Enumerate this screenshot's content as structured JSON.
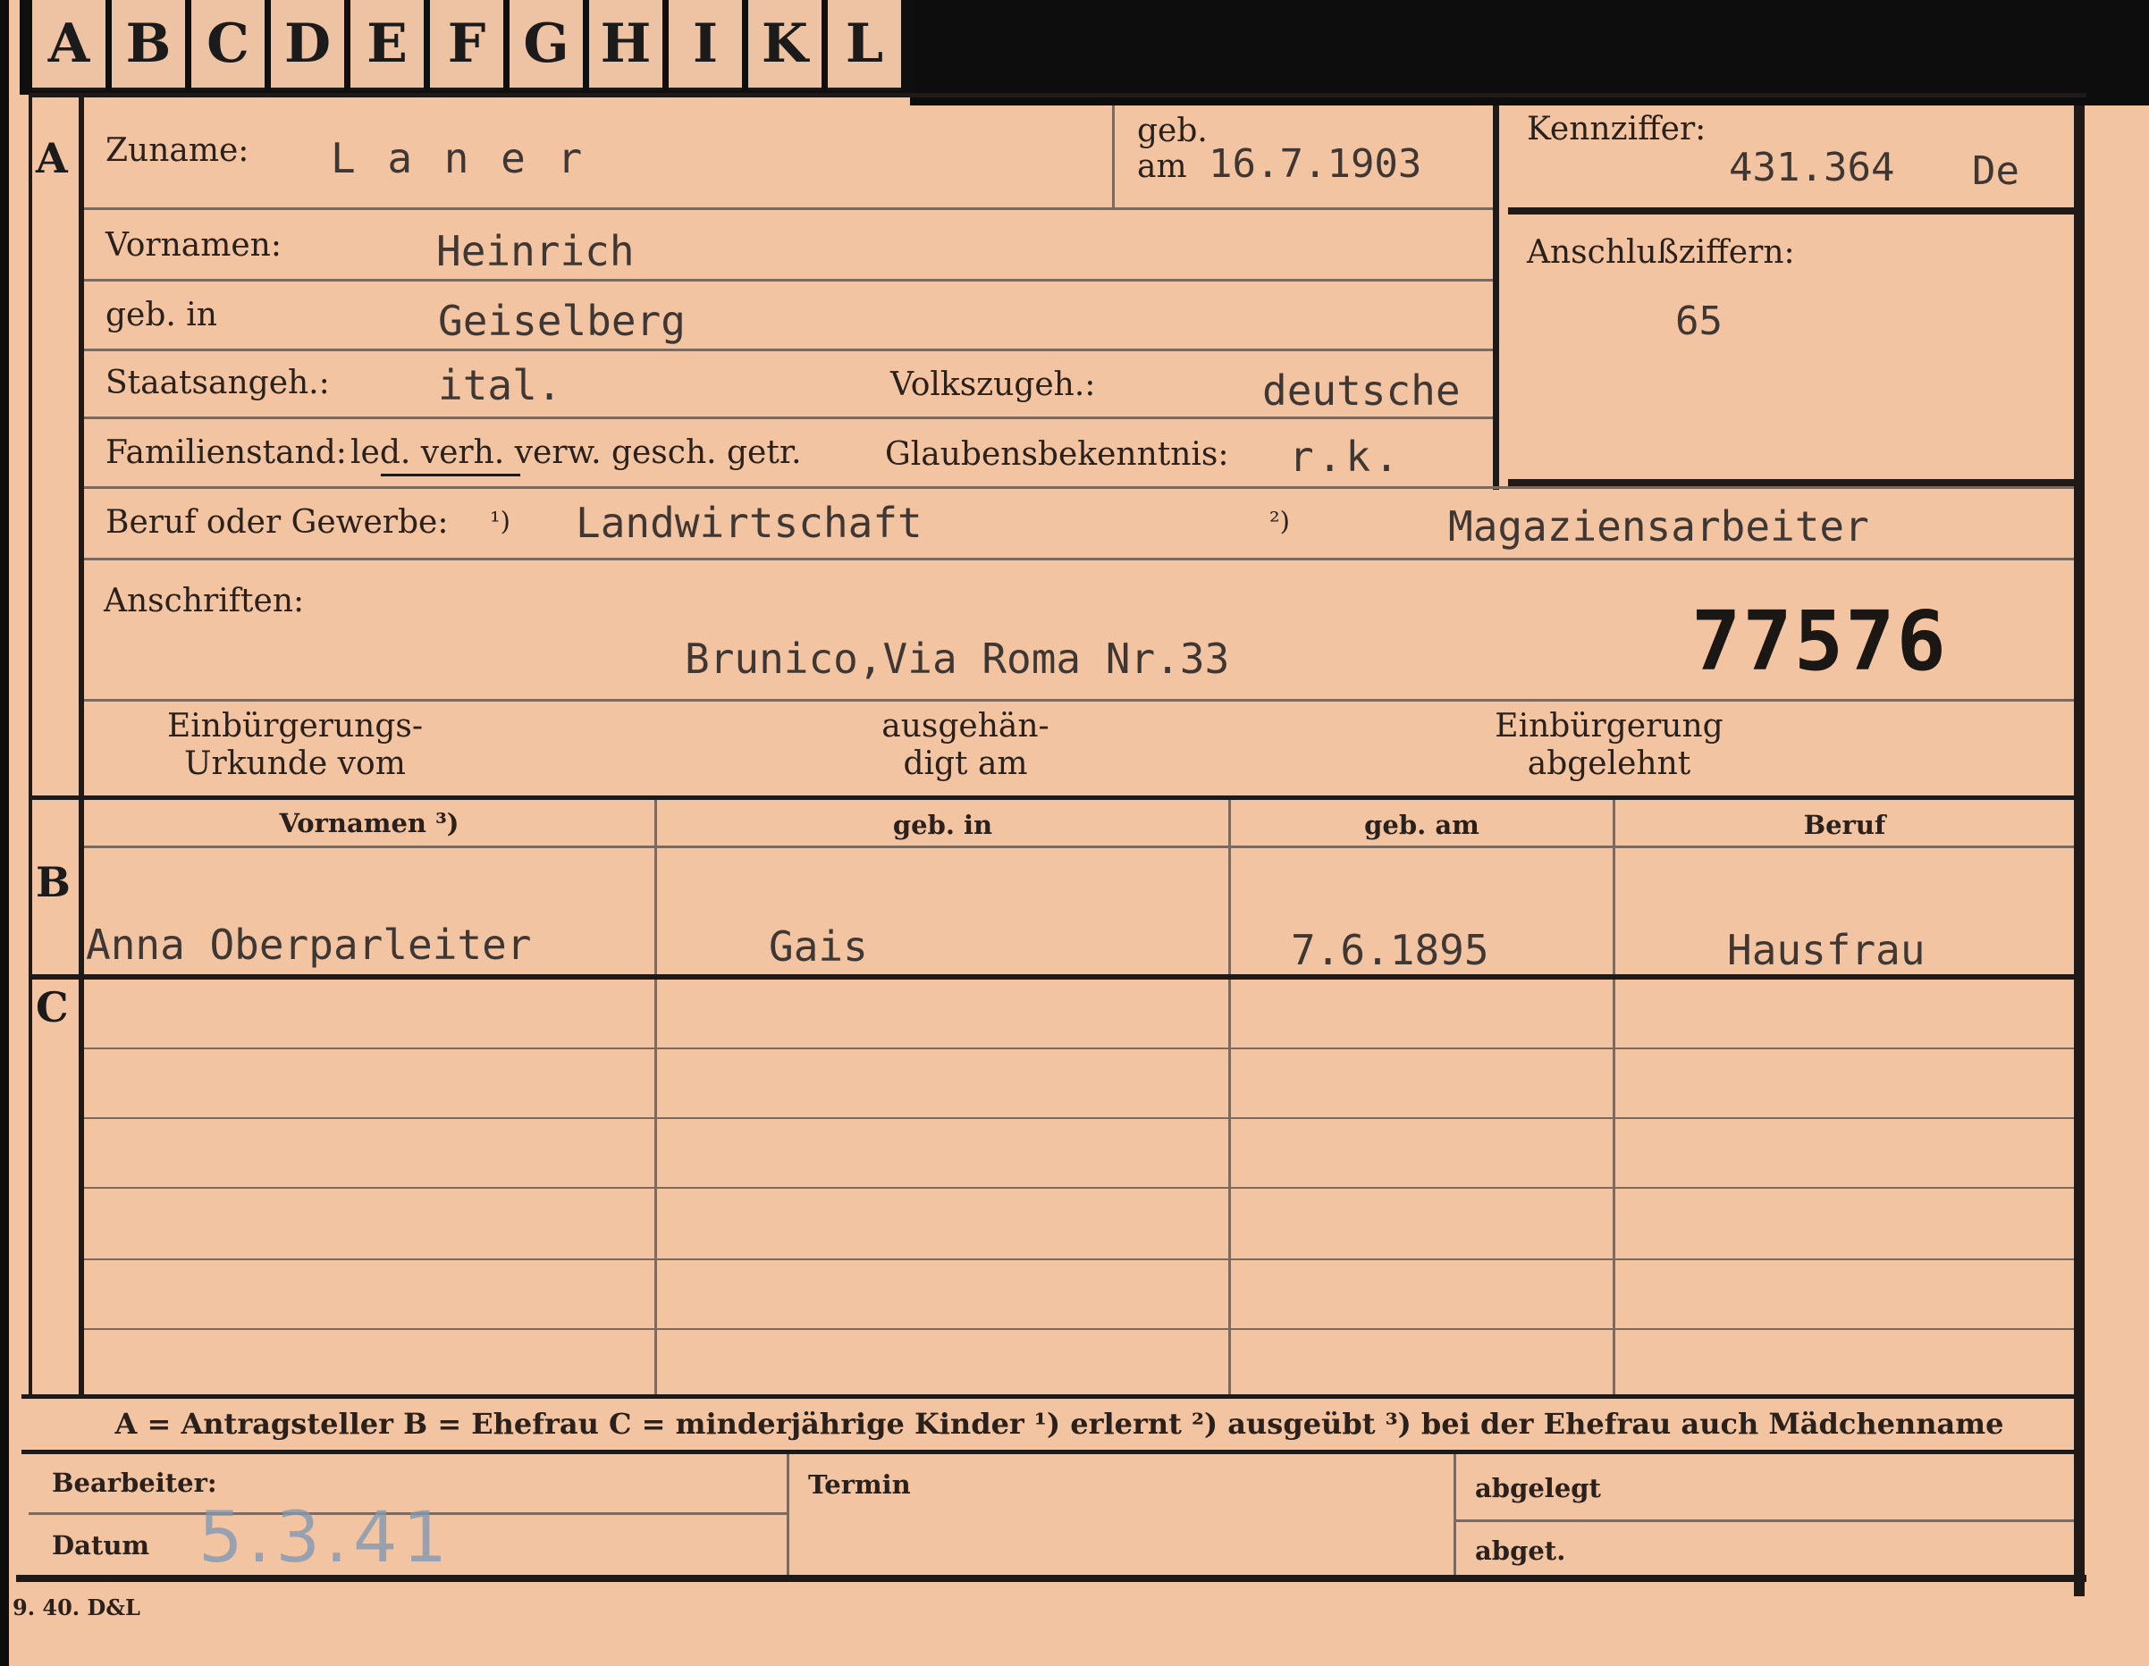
{
  "tabs": [
    "A",
    "B",
    "C",
    "D",
    "E",
    "F",
    "G",
    "H",
    "I",
    "K",
    "L"
  ],
  "sections": {
    "a": "A",
    "b": "B",
    "c": "C"
  },
  "header": {
    "surname_label": "Zuname:",
    "surname": "L a n e r",
    "born_label": "geb.",
    "born_am": "am",
    "born_date": "16.7.1903",
    "kennziffer_label": "Kennziffer:",
    "kennziffer": "431.364",
    "kennziffer_suffix": "De",
    "anschluss_label": "Anschlußziffern:",
    "anschluss": "65"
  },
  "fields": {
    "vornamen_label": "Vornamen:",
    "vornamen": "Heinrich",
    "gebin_label": "geb. in",
    "gebin": "Geiselberg",
    "staat_label": "Staatsangeh.:",
    "staat": "ital.",
    "volk_label": "Volkszugeh.:",
    "volk": "deutsche",
    "familien_label": "Familienstand:",
    "familien_options": "led. verh. verw. gesch. getr.",
    "glauben_label": "Glaubensbekenntnis:",
    "glauben": "r.k.",
    "beruf_label": "Beruf oder Gewerbe:",
    "beruf_mark1": "¹)",
    "beruf1": "Landwirtschaft",
    "beruf_mark2": "²)",
    "beruf2": "Magaziensarbeiter",
    "anschriften_label": "Anschriften:",
    "address": "Brunico,Via Roma Nr.33",
    "number": "77576"
  },
  "naturalization": {
    "urkunde_1": "Einbürgerungs-",
    "urkunde_2": "Urkunde vom",
    "ausgehaendigt_1": "ausgehän-",
    "ausgehaendigt_2": "digt am",
    "abgelehnt_1": "Einbürgerung",
    "abgelehnt_2": "abgelehnt"
  },
  "spouse_table": {
    "headers": [
      "Vornamen ³)",
      "geb. in",
      "geb. am",
      "Beruf"
    ],
    "row": [
      "Anna Oberparleiter",
      "Gais",
      "7.6.1895",
      "Hausfrau"
    ]
  },
  "legend": "A = Antragsteller   B = Ehefrau   C = minderjährige Kinder   ¹) erlernt   ²) ausgeübt   ³) bei der Ehefrau auch Mädchenname",
  "footer": {
    "bearbeiter_label": "Bearbeiter:",
    "datum_label": "Datum",
    "datum_stamp": "5.3.41",
    "termin_label": "Termin",
    "abgelegt_label": "abgelegt",
    "abgelegt2_label": "abget.",
    "print_code": "9. 40. D&L"
  },
  "colors": {
    "paper": "#f2c4a1",
    "ink": "#1f1a17",
    "stamp": "#7f98b3"
  }
}
